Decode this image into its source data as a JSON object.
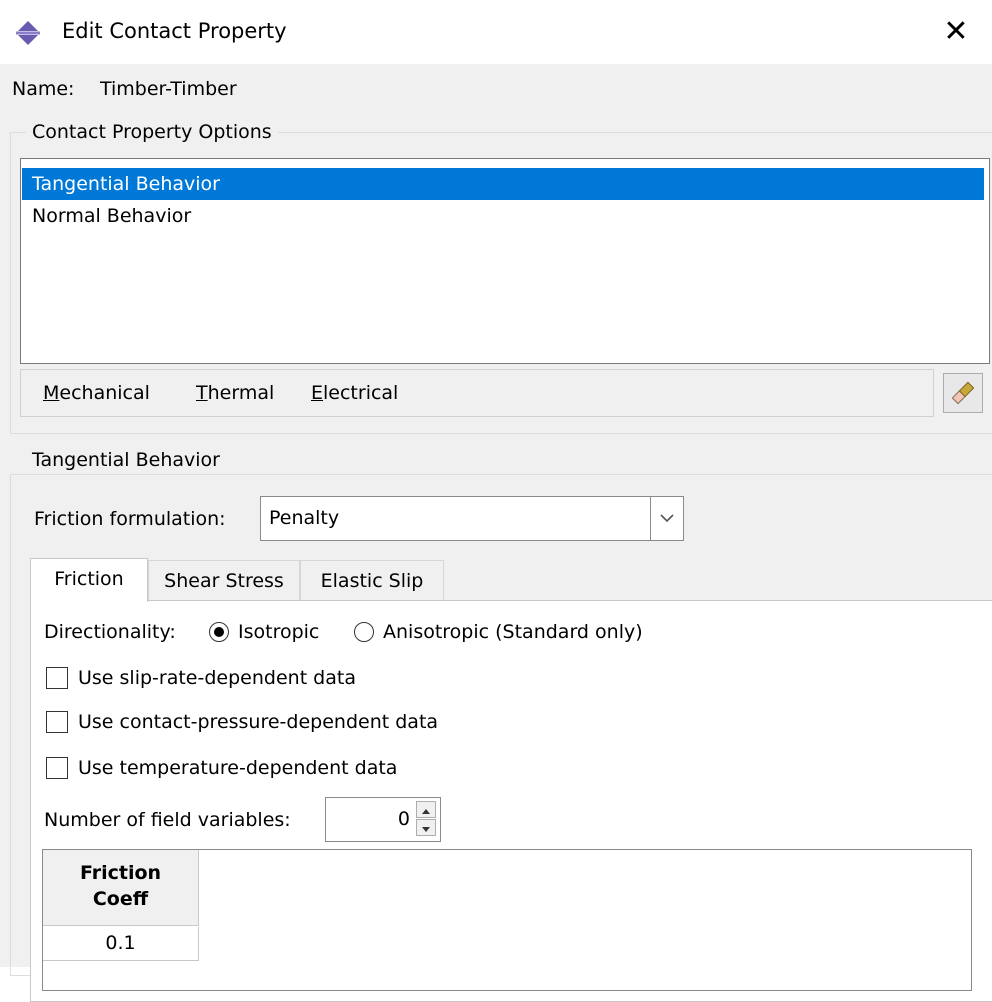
{
  "window": {
    "title": "Edit Contact Property",
    "close_symbol": "✕",
    "icon": "abaqus-contact-icon"
  },
  "name": {
    "label": "Name:",
    "value": "Timber-Timber"
  },
  "contact_property_options": {
    "legend": "Contact Property Options",
    "items": [
      {
        "label": "Tangential Behavior",
        "selected": true
      },
      {
        "label": "Normal Behavior",
        "selected": false
      }
    ],
    "menu": {
      "mechanical": "Mechanical",
      "thermal": "Thermal",
      "electrical": "Electrical"
    },
    "delete_icon": "eraser-icon"
  },
  "tangential_behavior": {
    "legend": "Tangential Behavior",
    "friction_formulation": {
      "label": "Friction formulation:",
      "value": "Penalty"
    },
    "tabs": [
      {
        "label": "Friction",
        "active": true
      },
      {
        "label": "Shear Stress",
        "active": false
      },
      {
        "label": "Elastic Slip",
        "active": false
      }
    ],
    "friction": {
      "directionality_label": "Directionality:",
      "isotropic_label": "Isotropic",
      "anisotropic_label": "Anisotropic (Standard only)",
      "directionality": "Isotropic",
      "checkboxes": {
        "slip_rate": {
          "label": "Use slip-rate-dependent data",
          "checked": false
        },
        "contact_pressure": {
          "label": "Use contact-pressure-dependent data",
          "checked": false
        },
        "temperature": {
          "label": "Use temperature-dependent data",
          "checked": false
        }
      },
      "field_variables": {
        "label": "Number of field variables:",
        "value": "0"
      },
      "table": {
        "header_line1": "Friction",
        "header_line2": "Coeff",
        "rows": [
          "0.1"
        ]
      }
    }
  },
  "colors": {
    "selection": "#0078d7",
    "dialog_bg": "#f0f0f0",
    "icon_purple": "#6a5bb0"
  }
}
